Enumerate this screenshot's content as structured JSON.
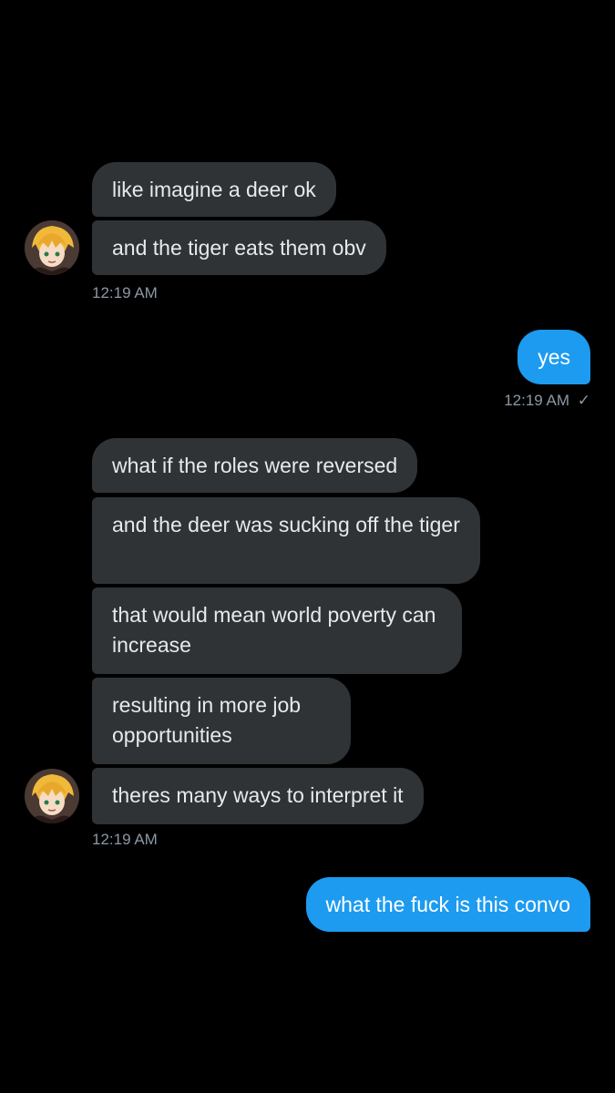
{
  "conversation": {
    "group1": {
      "messages": [
        "like imagine a deer ok",
        "and the tiger eats them obv"
      ],
      "time": "12:19 AM"
    },
    "reply1": {
      "text": "yes",
      "time": "12:19 AM",
      "status_icon": "check-icon"
    },
    "group2": {
      "messages": [
        "what if the roles were reversed",
        "and the deer was sucking off the tiger",
        "that would mean world poverty can increase",
        "resulting in more job opportunities",
        "theres many ways to interpret it"
      ],
      "time": "12:19 AM"
    },
    "reply2": {
      "text": "what the fuck is this convo"
    }
  },
  "colors": {
    "background": "#000000",
    "incoming_bubble": "#2f3336",
    "outgoing_bubble": "#1d9bf0",
    "timestamp": "#8b98a5"
  }
}
